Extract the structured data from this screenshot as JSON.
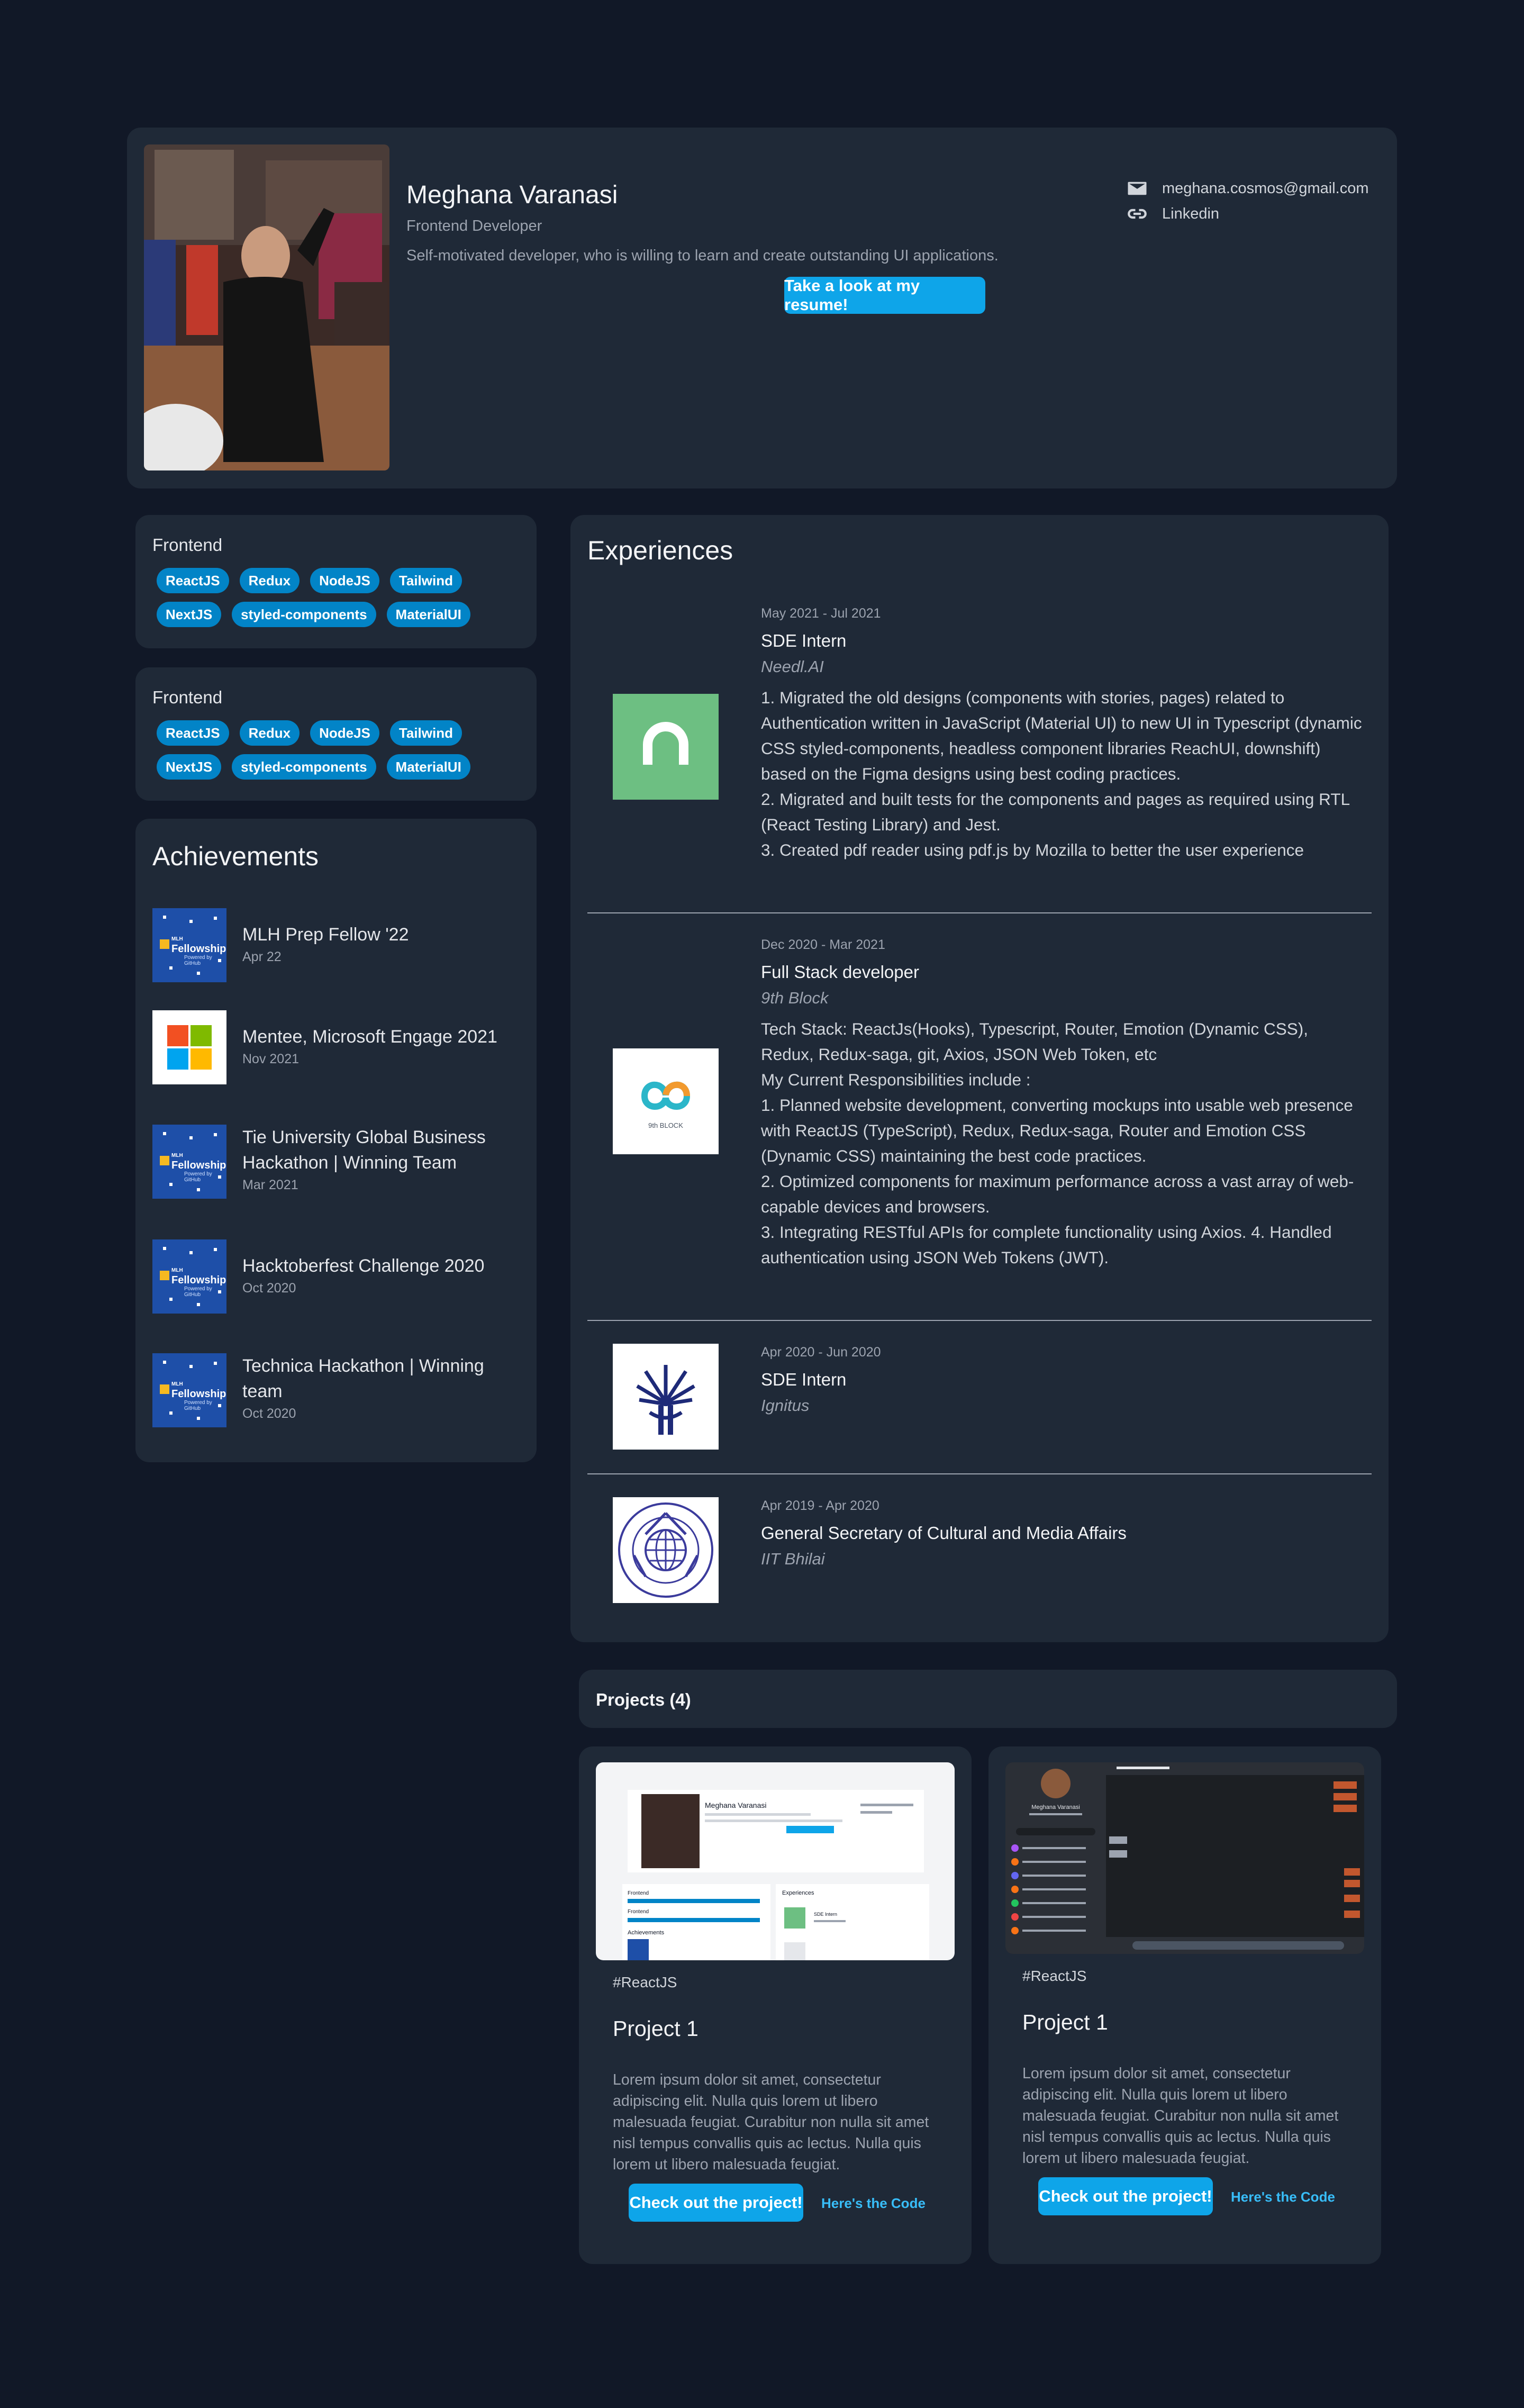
{
  "header": {
    "name": "Meghana Varanasi",
    "role": "Frontend Developer",
    "bio": "Self-motivated developer, who is willing to learn and create outstanding UI applications.",
    "resume_button": "Take a look at my resume!",
    "email": "meghana.cosmos@gmail.com",
    "linkedin": "Linkedin",
    "icons": [
      "mail-icon",
      "link-icon"
    ]
  },
  "skills": [
    {
      "title": "Frontend",
      "chips": [
        "ReactJS",
        "Redux",
        "NodeJS",
        "Tailwind",
        "NextJS",
        "styled-components",
        "MaterialUI"
      ]
    },
    {
      "title": "Frontend",
      "chips": [
        "ReactJS",
        "Redux",
        "NodeJS",
        "Tailwind",
        "NextJS",
        "styled-components",
        "MaterialUI"
      ]
    }
  ],
  "achievements": {
    "title": "Achievements",
    "items": [
      {
        "name": "MLH Prep Fellow '22",
        "date": "Apr 22",
        "icon": "mlh-fellowship-logo"
      },
      {
        "name": "Mentee, Microsoft Engage 2021",
        "date": "Nov 2021",
        "icon": "microsoft-logo"
      },
      {
        "name": "Tie University Global Business Hackathon | Winning Team",
        "date": "Mar 2021",
        "icon": "mlh-fellowship-logo"
      },
      {
        "name": "Hacktoberfest Challenge 2020",
        "date": "Oct 2020",
        "icon": "mlh-fellowship-logo"
      },
      {
        "name": "Technica Hackathon | Winning team",
        "date": "Oct 2020",
        "icon": "mlh-fellowship-logo"
      }
    ],
    "mlh_logo_text": {
      "small": "MLH",
      "big": "Fellowship",
      "sub": "Powered by GitHub"
    }
  },
  "experiences": {
    "title": "Experiences",
    "items": [
      {
        "date": "May 2021 - Jul 2021",
        "title": "SDE Intern",
        "company": "Needl.AI",
        "logo": "needl-logo",
        "description": "1. Migrated the old designs (components with stories, pages) related to Authentication written in JavaScript (Material UI) to new UI in Typescript (dynamic CSS styled-components, headless component libraries ReachUI, downshift) based on the Figma designs using best coding practices.\n2. Migrated and built tests for the components and pages as required using RTL (React Testing Library) and Jest.\n3. Created pdf reader using pdf.js by Mozilla to better the user experience"
      },
      {
        "date": "Dec 2020 - Mar 2021",
        "title": "Full Stack developer",
        "company": "9th Block",
        "logo": "9thblock-logo",
        "description": "Tech Stack: ReactJs(Hooks), Typescript, Router, Emotion (Dynamic CSS), Redux, Redux-saga, git, Axios, JSON Web Token, etc\nMy Current Responsibilities include :\n1. Planned website development, converting mockups into usable web presence with ReactJS (TypeScript), Redux, Redux-saga, Router and Emotion CSS (Dynamic CSS) maintaining the best code practices.\n2. Optimized components for maximum performance across a vast array of web-capable devices and browsers.\n3. Integrating RESTful APIs for complete functionality using Axios. 4. Handled authentication using JSON Web Tokens (JWT)."
      },
      {
        "date": "Apr 2020 - Jun 2020",
        "title": "SDE Intern",
        "company": "Ignitus",
        "logo": "ignitus-logo",
        "description": ""
      },
      {
        "date": "Apr 2019 - Apr 2020",
        "title": "General Secretary of Cultural and Media Affairs",
        "company": "IIT Bhilai",
        "logo": "iit-bhilai-logo",
        "description": ""
      }
    ],
    "logo_text": {
      "ninth_block": "9th BLOCK"
    }
  },
  "projects": {
    "title": "Projects (4)",
    "items": [
      {
        "tag": "#ReactJS",
        "name": "Project 1",
        "description": "Lorem ipsum dolor sit amet, consectetur adipiscing elit. Nulla quis lorem ut libero malesuada feugiat. Curabitur non nulla sit amet nisl tempus convallis quis ac lectus. Nulla quis lorem ut libero malesuada feugiat.",
        "button": "Check out the project!",
        "code_link": "Here's the Code",
        "preview_text": {
          "name": "Meghana Varanasi",
          "frontend": "Frontend",
          "experiences": "Experiences",
          "achievements": "Achievements",
          "sde": "SDE Intern"
        }
      },
      {
        "tag": "#ReactJS",
        "name": "Project 1",
        "description": "Lorem ipsum dolor sit amet, consectetur adipiscing elit. Nulla quis lorem ut libero malesuada feugiat. Curabitur non nulla sit amet nisl tempus convallis quis ac lectus. Nulla quis lorem ut libero malesuada feugiat.",
        "button": "Check out the project!",
        "code_link": "Here's the Code",
        "preview_text": {
          "name": "Meghana Varanasi"
        }
      }
    ]
  },
  "colors": {
    "background": "#111827",
    "card": "#1f2937",
    "accent": "#0ea5e9",
    "chip": "#0284c7"
  }
}
